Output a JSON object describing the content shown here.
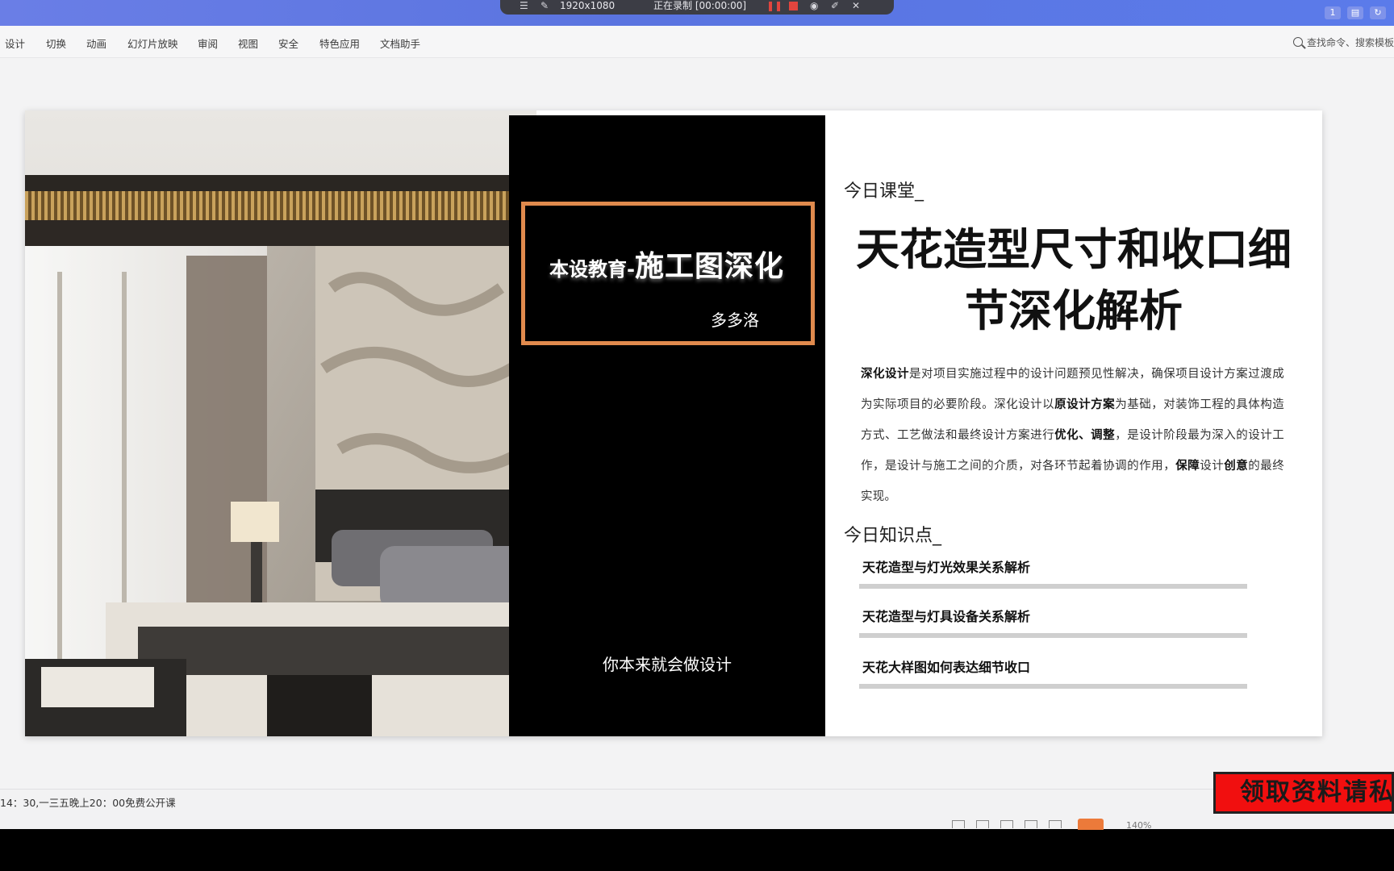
{
  "recorder": {
    "resolution": "1920x1080",
    "status": "正在录制 [00:00:00]",
    "icons": [
      "menu-icon",
      "pin-icon",
      "pause-icon",
      "stop-icon",
      "camera-icon",
      "pen-icon",
      "close-icon"
    ]
  },
  "top_right": {
    "badge": "1"
  },
  "ribbon": {
    "items": [
      "设计",
      "切换",
      "动画",
      "幻灯片放映",
      "审阅",
      "视图",
      "安全",
      "特色应用",
      "文档助手"
    ],
    "search_placeholder": "查找命令、搜索模板"
  },
  "slide": {
    "panel": {
      "brand_prefix": "本设教育-",
      "brand_main": "施工图深化",
      "author": "多多洛",
      "slogan": "你本来就会做设计"
    },
    "today_label": "今日课堂_",
    "title_line1": "天花造型尺寸和收口细",
    "title_line2": "节深化解析",
    "description": {
      "p1_bold": "深化设计",
      "p1": "是对项目实施过程中的设计问题预见性解决，确保项目设计方案过渡成为实际项目的必要阶段。深化设计以",
      "p2_bold": "原设计方案",
      "p2": "为基础，对装饰工程的具体构造方式、工艺做法和最终设计方案进行",
      "p3_bold": "优化、调整",
      "p3": "，是设计阶段最为深入的设计工作，是设计与施工之间的介质，对各环节起着协调的作用，",
      "p4_bold": "保障",
      "p4": "设计",
      "p5_bold": "创意",
      "p5": "的最终实现。"
    },
    "points_label": "今日知识点_",
    "points": [
      "天花造型与灯光效果关系解析",
      "天花造型与灯具设备关系解析",
      "天花大样图如何表达细节收口"
    ]
  },
  "status": {
    "note": "14：30,一三五晚上20：00免费公开课",
    "zoom": "140%"
  },
  "promo": {
    "text": "领取资料请私"
  },
  "colors": {
    "accent": "#e08a4d",
    "titlebar": "#5a74e0",
    "promo": "#f10f0f"
  }
}
